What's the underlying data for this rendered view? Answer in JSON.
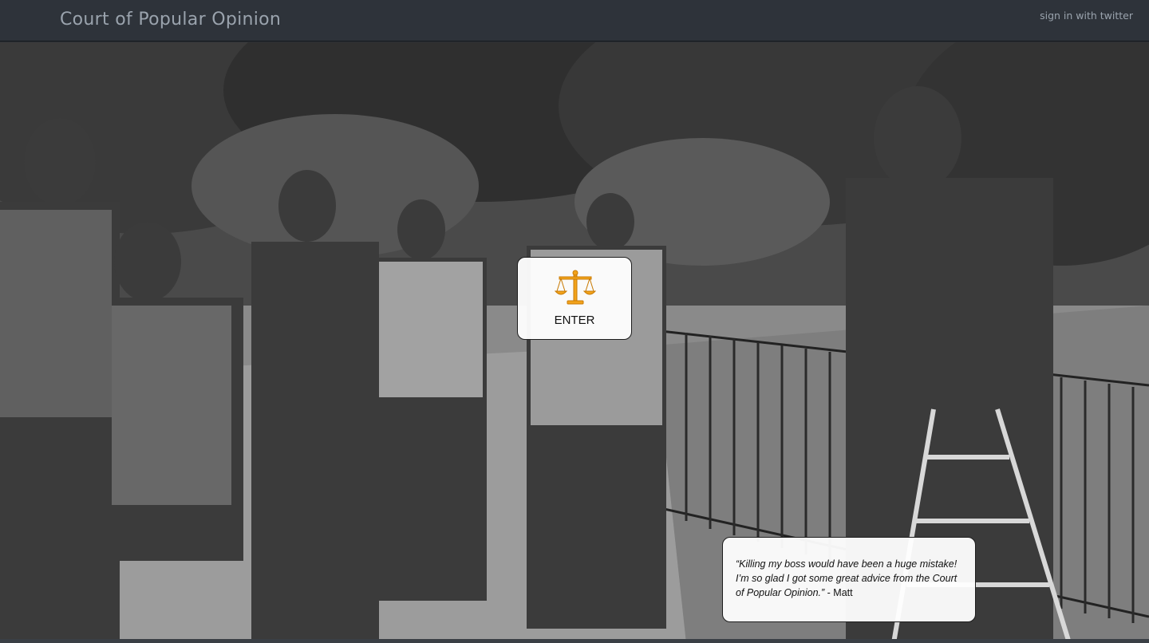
{
  "header": {
    "title": "Court of Popular Opinion",
    "signin_label": "sign in with twitter"
  },
  "enter": {
    "label": "ENTER",
    "icon": "scales-of-justice-icon",
    "icon_color": "#f2a31b"
  },
  "testimonial": {
    "quote": "“Killing my boss would have been a huge mistake! I’m so glad I got some great advice from the Court of Popular Opinion.”",
    "author": " - Matt"
  },
  "colors": {
    "navbar": "#2e333a",
    "navbar_text": "#9aa3ad"
  }
}
